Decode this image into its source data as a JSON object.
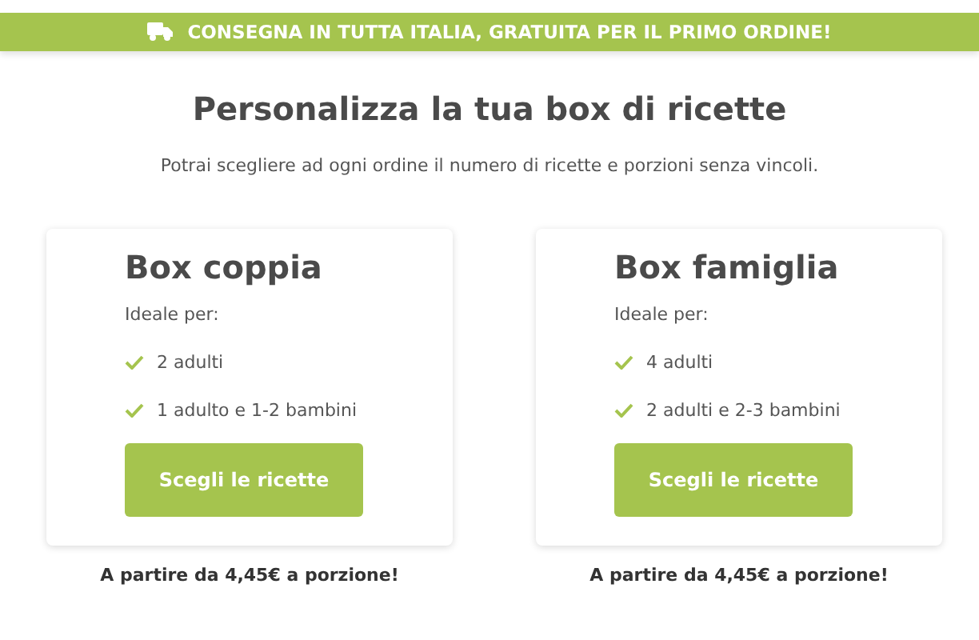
{
  "banner": {
    "text": "CONSEGNA IN TUTTA ITALIA, GRATUITA PER IL PRIMO ORDINE!"
  },
  "heading": "Personalizza la tua box di ricette",
  "subheading": "Potrai scegliere ad ogni ordine il numero di ricette e porzioni senza vincoli.",
  "plans": [
    {
      "title": "Box coppia",
      "intro": "Ideale per:",
      "features": [
        "2 adulti",
        "1 adulto e 1-2 bambini"
      ],
      "button": "Scegli le ricette",
      "price_note": "A partire da 4,45€ a porzione!"
    },
    {
      "title": "Box famiglia",
      "intro": "Ideale per:",
      "features": [
        "4 adulti",
        "2 adulti e 2-3 bambini"
      ],
      "button": "Scegli le ricette",
      "price_note": "A partire da 4,45€ a porzione!"
    }
  ]
}
